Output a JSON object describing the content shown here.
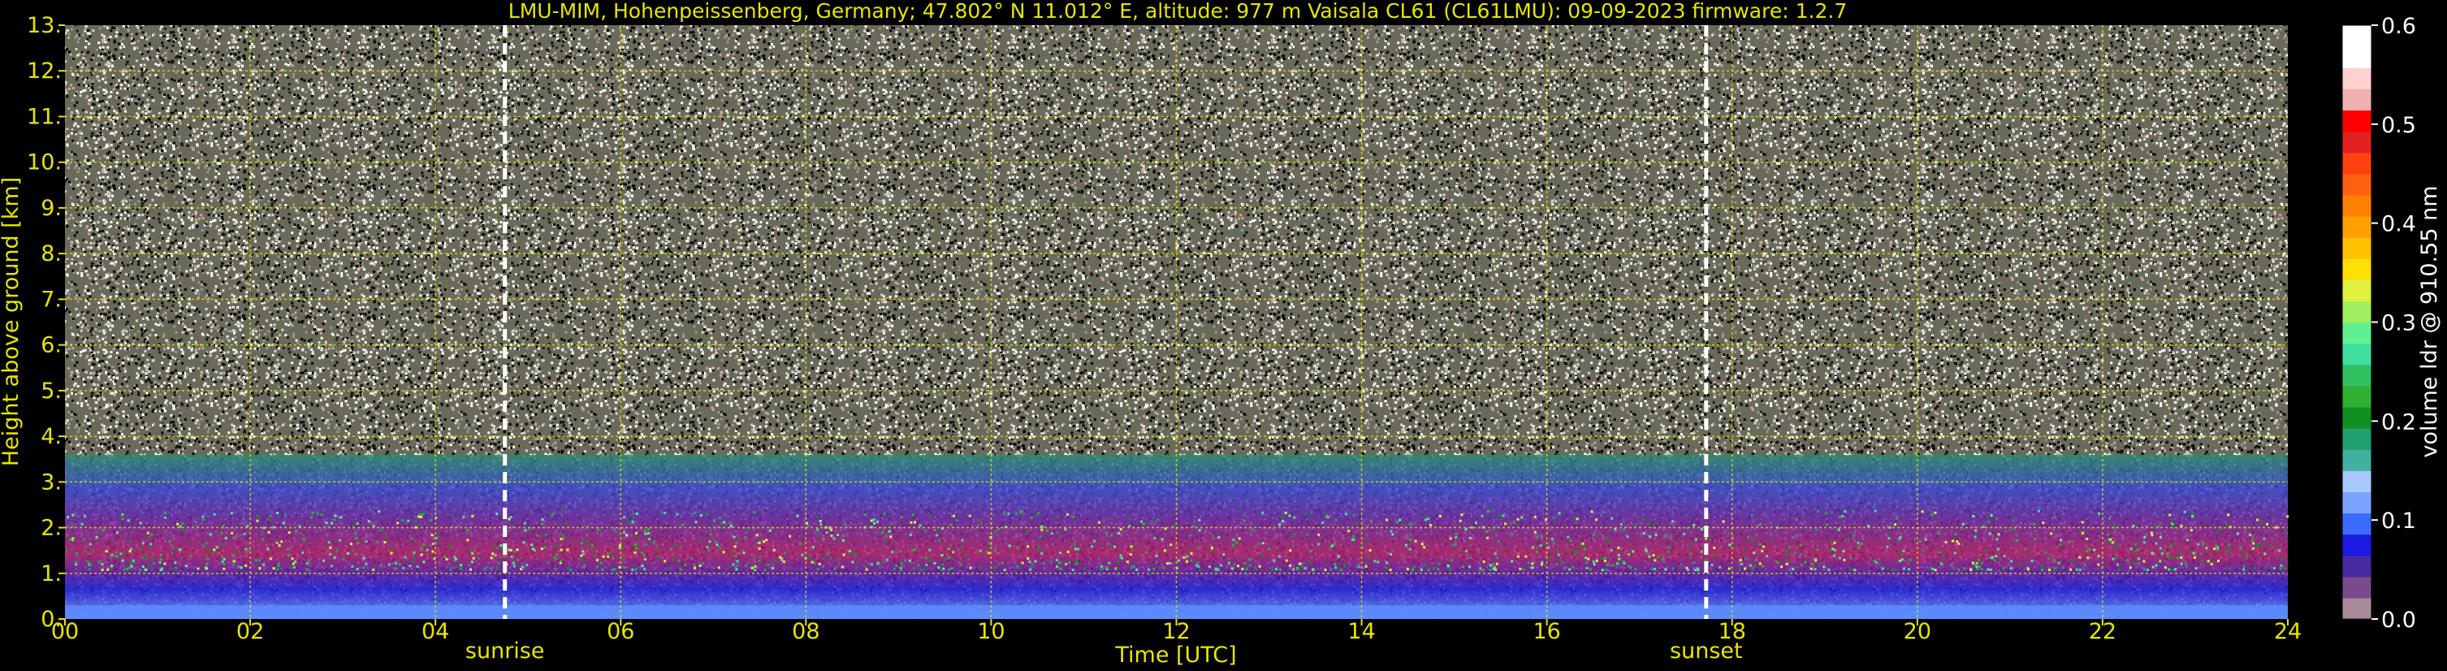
{
  "chart_data": {
    "type": "heatmap",
    "title": "LMU-MIM, Hohenpeissenberg, Germany; 47.802° N 11.012° E, altitude: 977 m    Vaisala CL61 (CL61LMU): 09-09-2023    firmware: 1.2.7",
    "xlabel": "Time [UTC]",
    "ylabel": "Height above ground [km]",
    "xlim": [
      0,
      24
    ],
    "ylim": [
      0,
      13
    ],
    "x_ticks": [
      "00",
      "02",
      "04",
      "06",
      "08",
      "10",
      "12",
      "14",
      "16",
      "18",
      "20",
      "22",
      "24"
    ],
    "x_tick_values": [
      0,
      2,
      4,
      6,
      8,
      10,
      12,
      14,
      16,
      18,
      20,
      22,
      24
    ],
    "y_ticks": [
      "0.",
      "1.",
      "2.",
      "3.",
      "4.",
      "5.",
      "6.",
      "7.",
      "8.",
      "9.",
      "10.",
      "11.",
      "12.",
      "13."
    ],
    "y_tick_values": [
      0,
      1,
      2,
      3,
      4,
      5,
      6,
      7,
      8,
      9,
      10,
      11,
      12,
      13
    ],
    "grid": true,
    "annotations": [
      {
        "label": "sunrise",
        "x": 4.75
      },
      {
        "label": "sunset",
        "x": 17.72
      }
    ],
    "colorbar": {
      "label": "volume ldr @ 910.55 nm",
      "range": [
        0.0,
        0.6
      ],
      "ticks": [
        "0.0",
        "0.1",
        "0.2",
        "0.3",
        "0.4",
        "0.5",
        "0.6"
      ],
      "tick_values": [
        0.0,
        0.1,
        0.2,
        0.3,
        0.4,
        0.5,
        0.6
      ],
      "colors": [
        "#a88a9a",
        "#7a4a8a",
        "#4a2aa0",
        "#1a1ae0",
        "#3a6aff",
        "#7aa4ff",
        "#a8c8ff",
        "#40b0a0",
        "#20a070",
        "#109020",
        "#30b030",
        "#30c060",
        "#40e0a0",
        "#60f090",
        "#a0f060",
        "#e0f040",
        "#ffe000",
        "#ffc000",
        "#ffa000",
        "#ff8000",
        "#ff6010",
        "#ff4010",
        "#e02020",
        "#ff0000",
        "#f0b0b0",
        "#ffd0d0",
        "#ffffff",
        "#ffffff"
      ]
    },
    "data_summary": [
      {
        "x_from": 0,
        "x_to": 24,
        "y_from": 0,
        "y_to": 0.3,
        "value": 0.05
      },
      {
        "x_from": 0,
        "x_to": 24,
        "y_from": 0.3,
        "y_to": 1.2,
        "value": 0.02
      },
      {
        "x_from": 0,
        "x_to": 24,
        "y_from": 1.2,
        "y_to": 2.2,
        "value": 0.18
      },
      {
        "x_from": 0,
        "x_to": 24,
        "y_from": 2.2,
        "y_to": 13,
        "value": "noise"
      }
    ]
  },
  "colors": {
    "axis_text": "#e6e600",
    "grid": "#e6e600",
    "background": "#000000",
    "colorbar_text": "#ffffff"
  }
}
